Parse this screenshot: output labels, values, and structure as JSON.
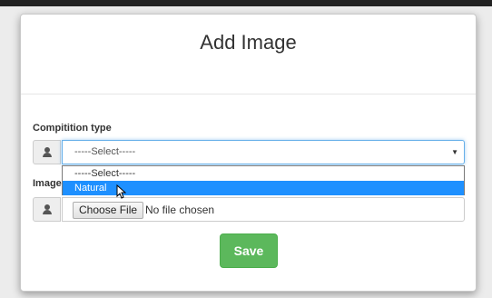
{
  "modal": {
    "title": "Add Image",
    "competition": {
      "label": "Compitition type",
      "selected": "-----Select-----",
      "options": [
        "-----Select-----",
        "Natural"
      ],
      "highlighted_index": 1,
      "user_icon": "user-icon"
    },
    "image": {
      "label": "Image",
      "button_label": "Choose File",
      "status": "No file chosen",
      "user_icon": "user-icon"
    },
    "save_label": "Save",
    "colors": {
      "save": "#5cb85c",
      "highlight": "#1e90ff",
      "focus_border": "#66afe9"
    }
  }
}
